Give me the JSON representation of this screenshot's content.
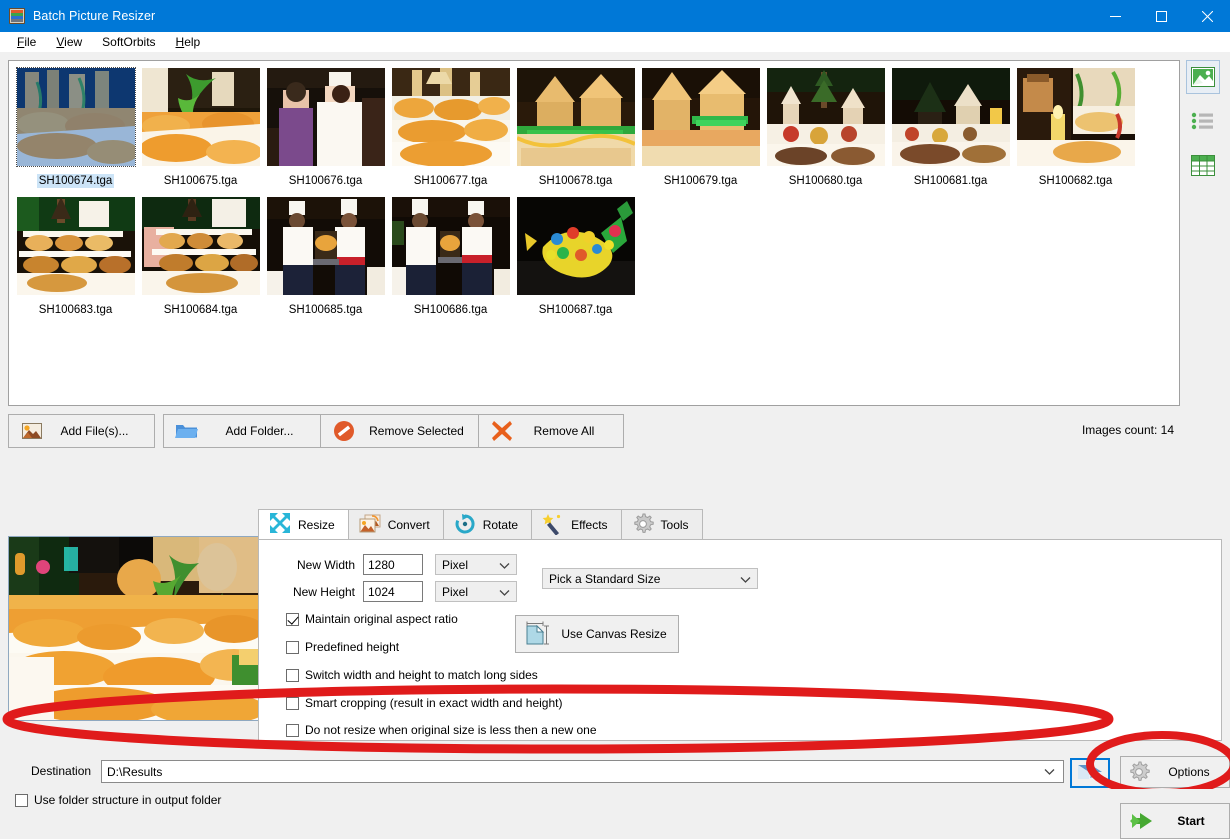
{
  "window": {
    "title": "Batch Picture Resizer",
    "icon": "app-icon",
    "minimize": "minimize-icon",
    "maximize": "maximize-icon",
    "close": "close-icon",
    "accent_color": "#0078d7"
  },
  "menubar": {
    "items": [
      {
        "label": "File",
        "mnemonic": "F"
      },
      {
        "label": "View",
        "mnemonic": "V"
      },
      {
        "label": "SoftOrbits",
        "mnemonic": ""
      },
      {
        "label": "Help",
        "mnemonic": "H"
      }
    ]
  },
  "filelist": {
    "items": [
      {
        "name": "SH100674.tga",
        "selected": true,
        "theme": "buffet-gold"
      },
      {
        "name": "SH100675.tga",
        "selected": false,
        "theme": "buffet-green"
      },
      {
        "name": "SH100676.tga",
        "selected": false,
        "theme": "chef-purple"
      },
      {
        "name": "SH100677.tga",
        "selected": false,
        "theme": "pastry-tower"
      },
      {
        "name": "SH100678.tga",
        "selected": false,
        "theme": "gingerbread-green"
      },
      {
        "name": "SH100679.tga",
        "selected": false,
        "theme": "gingerbread-yellow"
      },
      {
        "name": "SH100680.tga",
        "selected": false,
        "theme": "village-tree"
      },
      {
        "name": "SH100681.tga",
        "selected": false,
        "theme": "village-dark"
      },
      {
        "name": "SH100682.tga",
        "selected": false,
        "theme": "candle-cream"
      },
      {
        "name": "SH100683.tga",
        "selected": false,
        "theme": "dessert-shelf"
      },
      {
        "name": "SH100684.tga",
        "selected": false,
        "theme": "dessert-shelf2"
      },
      {
        "name": "SH100685.tga",
        "selected": false,
        "theme": "two-chefs"
      },
      {
        "name": "SH100686.tga",
        "selected": false,
        "theme": "two-chefs2"
      },
      {
        "name": "SH100687.tga",
        "selected": false,
        "theme": "fruit-fish"
      }
    ]
  },
  "viewbar": {
    "buttons": [
      {
        "name": "thumbnail-view-button",
        "icon": "picture-icon",
        "active": true
      },
      {
        "name": "list-view-button",
        "icon": "list-icon",
        "active": false
      },
      {
        "name": "details-view-button",
        "icon": "grid-icon",
        "active": false
      }
    ]
  },
  "actions": {
    "add_files": "Add File(s)...",
    "add_folder": "Add Folder...",
    "remove_selected": "Remove Selected",
    "remove_all": "Remove All",
    "images_count": "Images count: 14"
  },
  "tabs": [
    {
      "label": "Resize",
      "icon": "resize-arrows-icon",
      "active": true
    },
    {
      "label": "Convert",
      "icon": "convert-image-icon",
      "active": false
    },
    {
      "label": "Rotate",
      "icon": "rotate-arrow-icon",
      "active": false
    },
    {
      "label": "Effects",
      "icon": "magic-wand-icon",
      "active": false
    },
    {
      "label": "Tools",
      "icon": "gear-icon",
      "active": false
    }
  ],
  "resize_panel": {
    "new_width_label": "New Width",
    "new_width_value": "1280",
    "new_width_unit": "Pixel",
    "new_height_label": "New Height",
    "new_height_value": "1024",
    "new_height_unit": "Pixel",
    "standard_size_value": "Pick a Standard Size",
    "canvas_resize_label": "Use Canvas Resize",
    "checkboxes": [
      {
        "label": "Maintain original aspect ratio",
        "checked": true
      },
      {
        "label": "Predefined height",
        "checked": false
      },
      {
        "label": "Switch width and height to match long sides",
        "checked": false
      },
      {
        "label": "Smart cropping (result in exact width and height)",
        "checked": false
      },
      {
        "label": "Do not resize when original size is less then a new one",
        "checked": false
      }
    ]
  },
  "destination": {
    "label": "Destination",
    "value": "D:\\Results",
    "browse_icon": "browse-folder-icon",
    "options_label": "Options",
    "options_icon": "gear-icon",
    "start_label": "Start",
    "start_icon": "green-arrow-icon",
    "use_folder_structure_label": "Use folder structure in output folder",
    "use_folder_structure_checked": false
  },
  "annotations": {
    "color": "#e01b1b",
    "shapes": [
      {
        "name": "destination-highlight-ellipse"
      },
      {
        "name": "start-button-highlight-ellipse"
      }
    ]
  }
}
